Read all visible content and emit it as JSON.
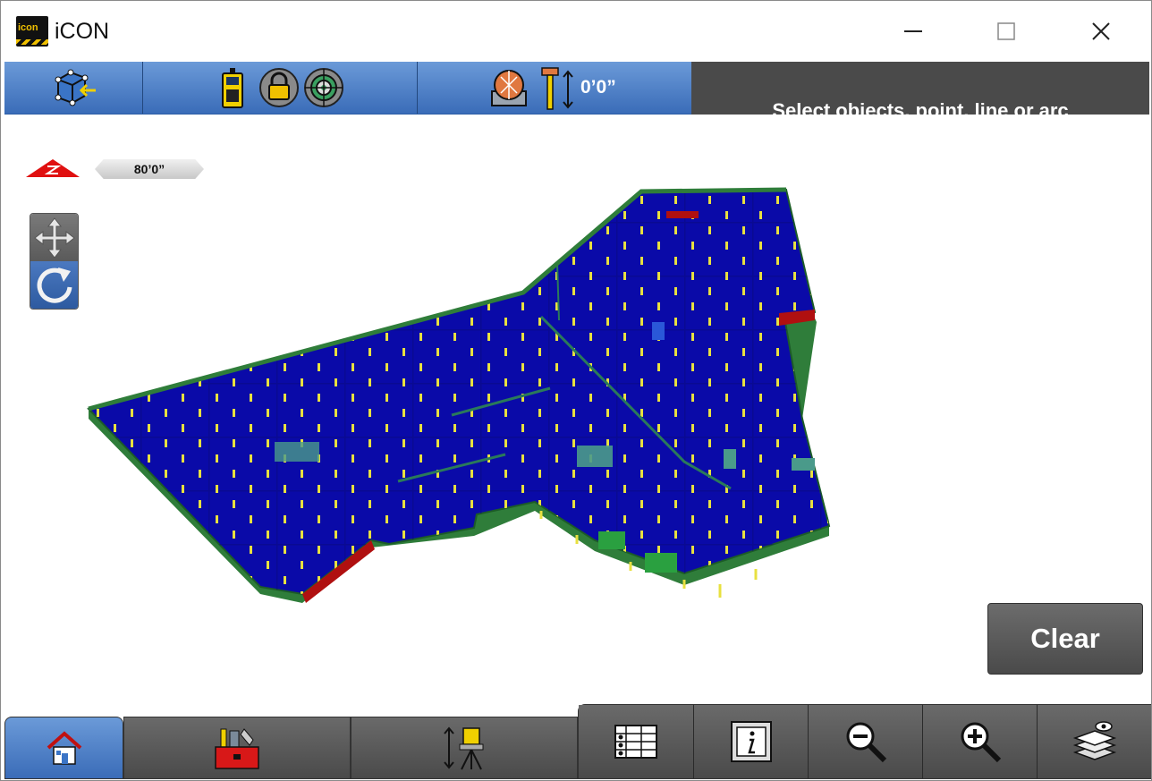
{
  "window": {
    "title": "iCON",
    "logo_text": "icon",
    "controls": {
      "minimize": "—",
      "maximize": "☐",
      "close": "✕"
    }
  },
  "toolbar": {
    "icons": [
      "select-3d-icon",
      "controller-icon",
      "lock-icon",
      "target-icon",
      "prism-icon",
      "height-rod-icon"
    ],
    "height_value": "0’0”"
  },
  "prompt": {
    "text": "Select objects, point, line or arc"
  },
  "viewport": {
    "scale_label": "80’0”",
    "north_icon": "north-arrow-icon",
    "model_colors": {
      "floor": "#0a0aa8",
      "column": "#e6e040",
      "edge": "#2f7d3a",
      "wall_red": "#b01010"
    }
  },
  "actions": {
    "clear_label": "Clear"
  },
  "bottom_nav": {
    "tabs": [
      "home-icon",
      "toolbox-icon",
      "stakeout-icon"
    ],
    "buttons": [
      "table-icon",
      "info-icon",
      "zoom-out-icon",
      "zoom-in-icon",
      "layers-icon"
    ]
  }
}
